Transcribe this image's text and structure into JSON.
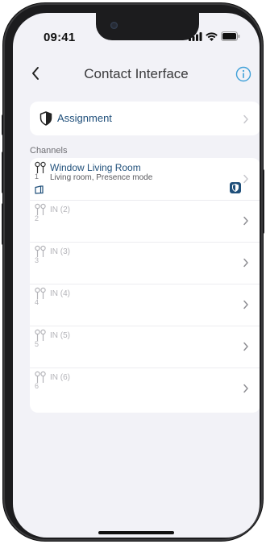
{
  "status_bar": {
    "time": "09:41",
    "icons": [
      "cellular-signal-icon",
      "wifi-icon",
      "battery-icon"
    ]
  },
  "nav": {
    "back_icon": "chevron-left-icon",
    "title": "Contact Interface",
    "info_icon": "info-circle-icon"
  },
  "assignment": {
    "icon": "shield-icon",
    "label": "Assignment"
  },
  "channels": {
    "header": "Channels",
    "items": [
      {
        "number": "1",
        "title": "Window Living Room",
        "subtitle": "Living room, Presence mode",
        "active": true
      },
      {
        "number": "2",
        "title": "IN (2)",
        "active": false
      },
      {
        "number": "3",
        "title": "IN (3)",
        "active": false
      },
      {
        "number": "4",
        "title": "IN (4)",
        "active": false
      },
      {
        "number": "5",
        "title": "IN (5)",
        "active": false
      },
      {
        "number": "6",
        "title": "IN (6)",
        "active": false
      }
    ]
  },
  "colors": {
    "accent": "#1f4f7a",
    "info": "#3fa0d8",
    "background": "#f2f2f7",
    "inactive_text": "#b3b3b8"
  }
}
